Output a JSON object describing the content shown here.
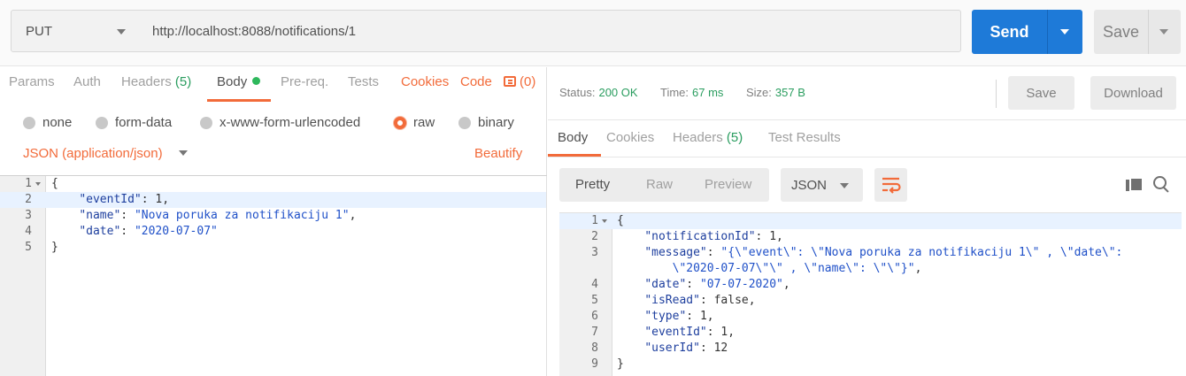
{
  "request": {
    "method": "PUT",
    "url": "http://localhost:8088/notifications/1",
    "send_label": "Send",
    "save_label": "Save"
  },
  "request_tabs": {
    "params": "Params",
    "auth": "Auth",
    "headers": "Headers",
    "headers_count": "(5)",
    "body": "Body",
    "prereq": "Pre-req.",
    "tests": "Tests",
    "cookies": "Cookies",
    "code": "Code",
    "comments_count": "(0)"
  },
  "body_types": {
    "none": "none",
    "form_data": "form-data",
    "urlencoded": "x-www-form-urlencoded",
    "raw": "raw",
    "binary": "binary",
    "selected": "raw"
  },
  "body_format": {
    "content_type": "JSON (application/json)",
    "beautify": "Beautify"
  },
  "request_body": {
    "line_numbers": [
      "1",
      "2",
      "3",
      "4",
      "5"
    ],
    "open_brace": "{",
    "close_brace": "}",
    "k_eventId": "\"eventId\"",
    "v_eventId": "1",
    "k_name": "\"name\"",
    "v_name": "\"Nova poruka za notifikaciju 1\"",
    "k_date": "\"date\"",
    "v_date": "\"2020-07-07\""
  },
  "response_status": {
    "status_label": "Status:",
    "status_value": "200 OK",
    "time_label": "Time:",
    "time_value": "67 ms",
    "size_label": "Size:",
    "size_value": "357 B",
    "save_label": "Save",
    "download_label": "Download"
  },
  "response_tabs": {
    "body": "Body",
    "cookies": "Cookies",
    "headers": "Headers",
    "headers_count": "(5)",
    "test_results": "Test Results"
  },
  "response_view": {
    "pretty": "Pretty",
    "raw": "Raw",
    "preview": "Preview",
    "format": "JSON"
  },
  "response_body": {
    "line_numbers": [
      "1",
      "2",
      "3",
      "",
      "4",
      "5",
      "6",
      "7",
      "8",
      "9"
    ],
    "open_brace": "{",
    "close_brace": "}",
    "k_notificationId": "\"notificationId\"",
    "v_notificationId": "1",
    "k_message": "\"message\"",
    "v_message_1": "\"{\\\"event\\\": \\\"Nova poruka za notifikaciju 1\\\" , \\\"date\\\":",
    "v_message_2": "\\\"2020-07-07\\\"\\\" , \\\"name\\\": \\\"\\\"}\"",
    "k_date": "\"date\"",
    "v_date": "\"07-07-2020\"",
    "k_isRead": "\"isRead\"",
    "v_isRead": "false",
    "k_type": "\"type\"",
    "v_type": "1",
    "k_eventId": "\"eventId\"",
    "v_eventId": "1",
    "k_userId": "\"userId\"",
    "v_userId": "12"
  },
  "colors": {
    "accent": "#f26b3a",
    "send_blue": "#1e7ad8",
    "status_green": "#2a9d5f"
  },
  "icons": {
    "method_caret": "chevron-down-icon",
    "comment": "comment-icon",
    "copy": "copy-icon",
    "search": "search-icon",
    "wrap": "wrap-lines-icon"
  }
}
